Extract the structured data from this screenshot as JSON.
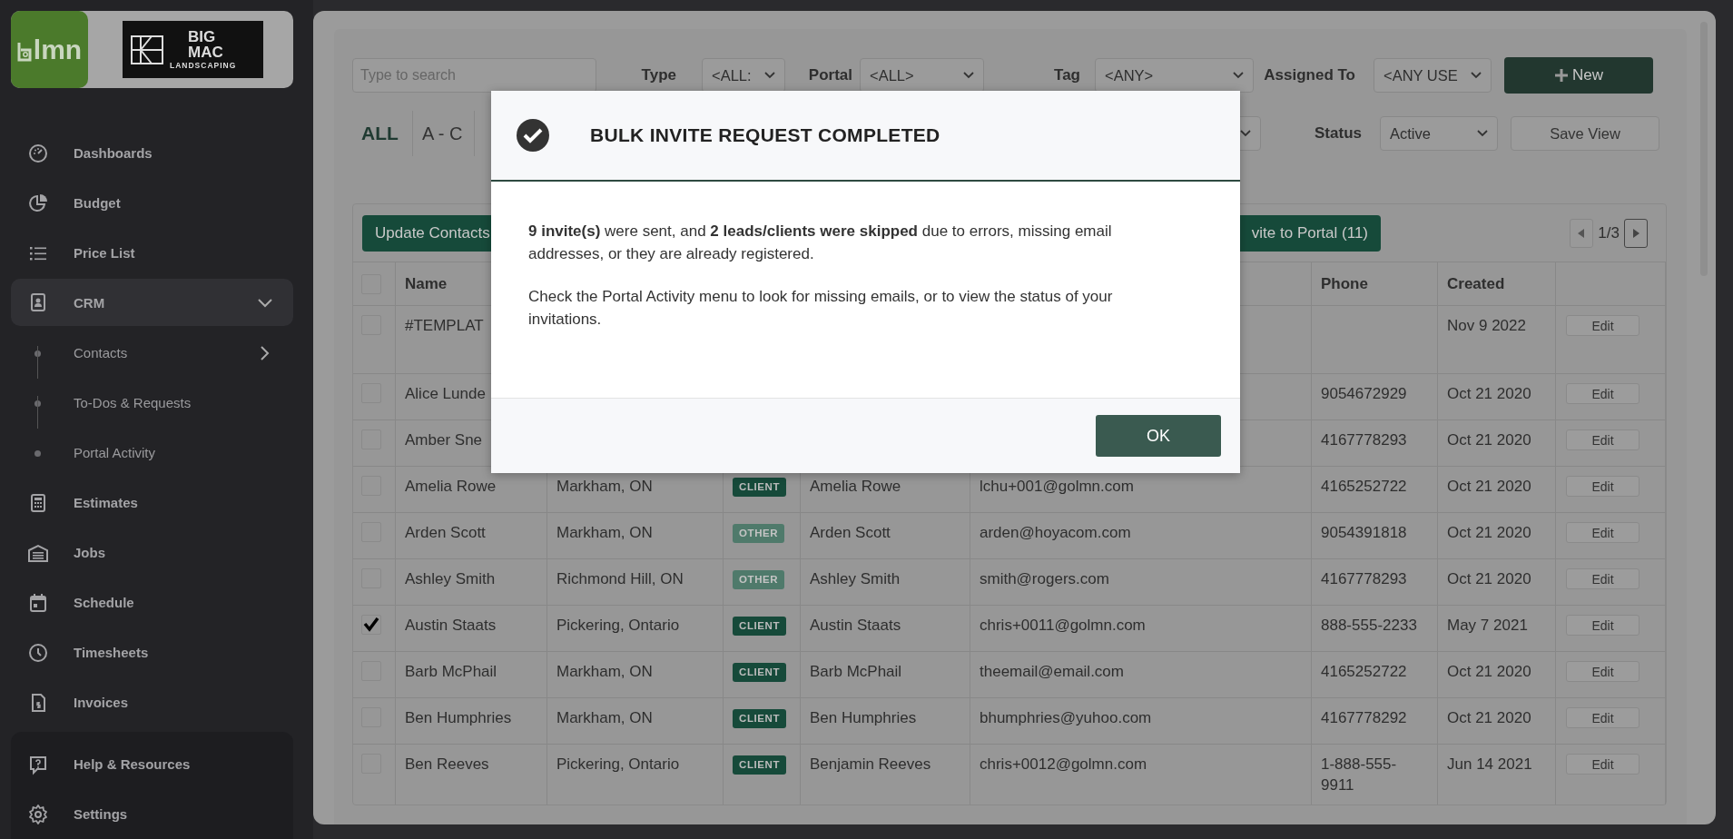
{
  "sidebar": {
    "app_logo": "lmn",
    "company_logo": {
      "line1": "BIG",
      "line2": "MAC",
      "line3": "LANDSCAPING"
    },
    "items": [
      {
        "label": "Dashboards",
        "selected": false
      },
      {
        "label": "Budget",
        "selected": false
      },
      {
        "label": "Price List",
        "selected": false
      },
      {
        "label": "CRM",
        "selected": true,
        "expanded": true,
        "children": [
          {
            "label": "Contacts",
            "expandable": true
          },
          {
            "label": "To-Dos & Requests",
            "expandable": false
          },
          {
            "label": "Portal Activity",
            "expandable": false
          }
        ]
      },
      {
        "label": "Estimates",
        "selected": false
      },
      {
        "label": "Jobs",
        "selected": false
      },
      {
        "label": "Schedule",
        "selected": false
      },
      {
        "label": "Timesheets",
        "selected": false
      },
      {
        "label": "Invoices",
        "selected": false
      }
    ],
    "footer_items": [
      {
        "label": "Help & Resources"
      },
      {
        "label": "Settings"
      }
    ]
  },
  "filters": {
    "search": {
      "placeholder": "Type to search"
    },
    "type": {
      "label": "Type",
      "value": "<ALL:"
    },
    "portal": {
      "label": "Portal",
      "value": "<ALL>"
    },
    "tag": {
      "label": "Tag",
      "value": "<ANY>"
    },
    "assigned_to": {
      "label": "Assigned To",
      "value": "<ANY USE"
    },
    "status": {
      "label": "Status",
      "value": "Active"
    },
    "new_button": "New",
    "save_view_button": "Save View"
  },
  "letter_tabs": [
    {
      "label": "ALL",
      "selected": true
    },
    {
      "label": "A - C",
      "selected": false
    }
  ],
  "toolbar": {
    "buttons": [
      "Update Contacts",
      "vite to Portal (11)"
    ],
    "page": "1/3"
  },
  "table": {
    "select_all": {
      "checked": false
    },
    "columns": {
      "name": "Name",
      "phone": "Phone",
      "created": "Created"
    },
    "rows": [
      {
        "checked": false,
        "name": "#TEMPLAT",
        "created": "Nov 9 2022",
        "action": "Edit"
      },
      {
        "checked": false,
        "name": "Alice Lunde",
        "phone": "9054672929",
        "created": "Oct 21 2020",
        "action": "Edit"
      },
      {
        "checked": false,
        "name": "Amber Sne",
        "phone": "4167778293",
        "created": "Oct 21 2020",
        "action": "Edit"
      },
      {
        "checked": false,
        "name": "Amelia Rowe",
        "city": "Markham, ON",
        "tag": {
          "label": "CLIENT",
          "kind": "client"
        },
        "contact": "Amelia Rowe",
        "email": "lchu+001@golmn.com",
        "phone": "4165252722",
        "created": "Oct 21 2020",
        "action": "Edit"
      },
      {
        "checked": false,
        "name": "Arden Scott",
        "city": "Markham, ON",
        "tag": {
          "label": "OTHER",
          "kind": "other"
        },
        "contact": "Arden Scott",
        "email": "arden@hoyacom.com",
        "phone": "9054391818",
        "created": "Oct 21 2020",
        "action": "Edit"
      },
      {
        "checked": false,
        "name": "Ashley Smith",
        "city": "Richmond Hill, ON",
        "tag": {
          "label": "OTHER",
          "kind": "other"
        },
        "contact": "Ashley Smith",
        "email": "smith@rogers.com",
        "phone": "4167778293",
        "created": "Oct 21 2020",
        "action": "Edit"
      },
      {
        "checked": true,
        "name": "Austin Staats",
        "city": "Pickering, Ontario",
        "tag": {
          "label": "CLIENT",
          "kind": "client"
        },
        "contact": "Austin Staats",
        "email": "chris+0011@golmn.com",
        "phone": "888-555-2233",
        "created": "May 7 2021",
        "action": "Edit"
      },
      {
        "checked": false,
        "name": "Barb McPhail",
        "city": "Markham, ON",
        "tag": {
          "label": "CLIENT",
          "kind": "client"
        },
        "contact": "Barb McPhail",
        "email": "theemail@email.com",
        "phone": "4165252722",
        "created": "Oct 21 2020",
        "action": "Edit"
      },
      {
        "checked": false,
        "name": "Ben Humphries",
        "city": "Markham, ON",
        "tag": {
          "label": "CLIENT",
          "kind": "client"
        },
        "contact": "Ben Humphries",
        "email": "bhumphries@yuhoo.com",
        "phone": "4167778292",
        "created": "Oct 21 2020",
        "action": "Edit"
      },
      {
        "checked": false,
        "name": "Ben Reeves",
        "city": "Pickering, Ontario",
        "tag": {
          "label": "CLIENT",
          "kind": "client"
        },
        "contact": "Benjamin Reeves",
        "email": "chris+0012@golmn.com",
        "phone": "1-888-555-9911",
        "created": "Jun 14 2021",
        "action": "Edit"
      }
    ]
  },
  "dialog": {
    "title": "BULK INVITE REQUEST COMPLETED",
    "paragraphs": [
      "**9 invite(s)** were sent, and **2 leads/clients were skipped** due to errors, missing email addresses, or they are already registered.",
      "Check the Portal Activity menu to look for missing emails, or to view the status of your invitations."
    ],
    "button": "OK"
  }
}
